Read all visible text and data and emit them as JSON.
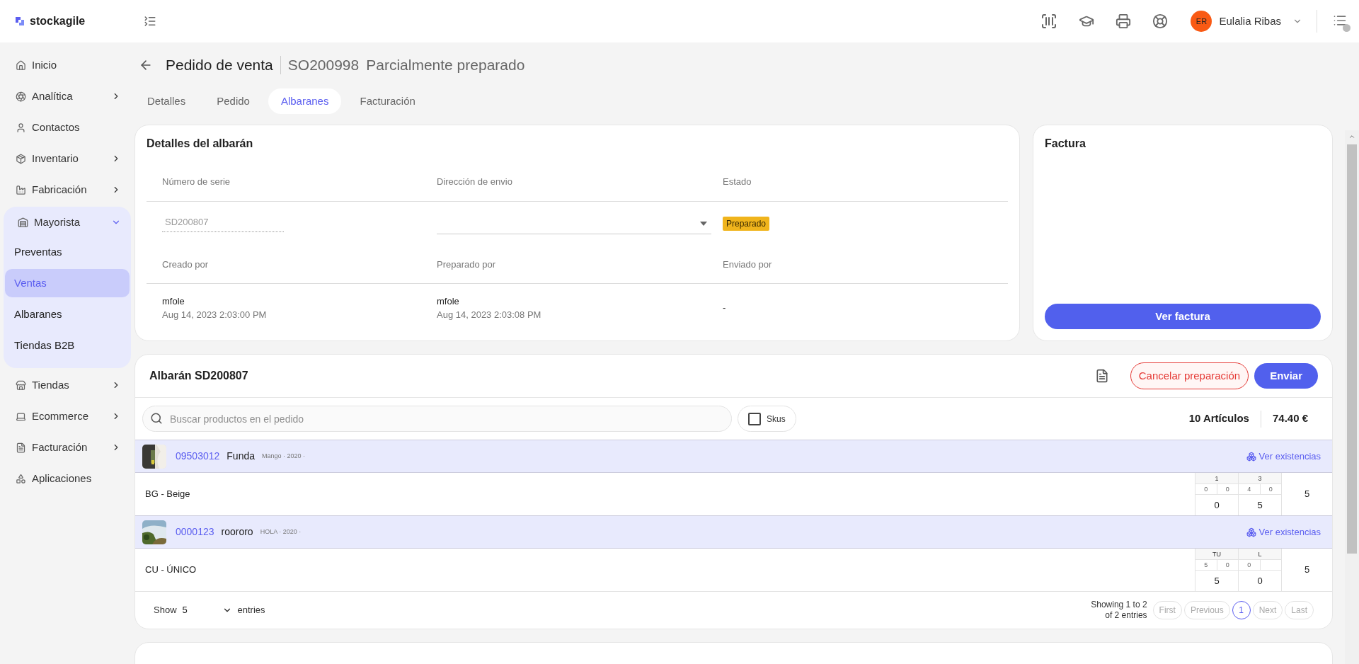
{
  "brand": {
    "name": "stockagile"
  },
  "topbar": {
    "user": {
      "initials": "ER",
      "name": "Eulalia Ribas"
    }
  },
  "sidebar": {
    "items": [
      {
        "label": "Inicio",
        "has_children": false,
        "expanded": false
      },
      {
        "label": "Analítica",
        "has_children": true,
        "expanded": false
      },
      {
        "label": "Contactos",
        "has_children": false,
        "expanded": false
      },
      {
        "label": "Inventario",
        "has_children": true,
        "expanded": false
      },
      {
        "label": "Fabricación",
        "has_children": true,
        "expanded": false
      },
      {
        "label": "Mayorista",
        "has_children": true,
        "expanded": true,
        "children": [
          {
            "label": "Preventas",
            "selected": false
          },
          {
            "label": "Ventas",
            "selected": true
          },
          {
            "label": "Albaranes",
            "selected": false
          },
          {
            "label": "Tiendas B2B",
            "selected": false
          }
        ]
      },
      {
        "label": "Tiendas",
        "has_children": true,
        "expanded": false
      },
      {
        "label": "Ecommerce",
        "has_children": true,
        "expanded": false
      },
      {
        "label": "Facturación",
        "has_children": true,
        "expanded": false
      },
      {
        "label": "Aplicaciones",
        "has_children": false,
        "expanded": false
      }
    ]
  },
  "page": {
    "title": "Pedido de venta",
    "code": "SO200998",
    "status": "Parcialmente preparado"
  },
  "tabs": [
    {
      "label": "Detalles",
      "selected": false
    },
    {
      "label": "Pedido",
      "selected": false
    },
    {
      "label": "Albaranes",
      "selected": true
    },
    {
      "label": "Facturación",
      "selected": false
    }
  ],
  "details": {
    "title": "Detalles del albarán",
    "labels_1": [
      "Número de serie",
      "Dirección de envio",
      "Estado"
    ],
    "serial": "SD200807",
    "status_badge": "Preparado",
    "labels_2": [
      "Creado por",
      "Preparado por",
      "Enviado por"
    ],
    "people": [
      {
        "user": "mfole",
        "date": "Aug 14, 2023 2:03:00 PM"
      },
      {
        "user": "mfole",
        "date": "Aug 14, 2023 2:03:08 PM"
      }
    ],
    "sent_by": "-"
  },
  "invoice": {
    "title": "Factura",
    "button": "Ver factura"
  },
  "albaran": {
    "title": "Albarán SD200807",
    "cancel": "Cancelar preparación",
    "send": "Enviar",
    "search_placeholder": "Buscar productos en el pedido",
    "skus": {
      "label": "Skus",
      "checked": false
    },
    "items_count": "10 Artículos",
    "total": "74.40 €",
    "products": [
      {
        "code": "09503012",
        "name": "Funda",
        "meta": "Mango · 2020 ·",
        "link": "Ver existencias",
        "variant": "BG - Beige",
        "matrix": [
          {
            "header": "1",
            "sub": [
              "0",
              "0"
            ],
            "value": "0"
          },
          {
            "header": "3",
            "sub": [
              "4",
              "0"
            ],
            "value": "5"
          }
        ],
        "total": "5"
      },
      {
        "code": "0000123",
        "name": "roororo",
        "meta": "HOLA · 2020 ·",
        "link": "Ver existencias",
        "variant": "CU - ÚNICO",
        "matrix": [
          {
            "header": "TU",
            "sub": [
              "5",
              "0"
            ],
            "value": "5"
          },
          {
            "header": "L",
            "sub": [
              "0"
            ],
            "value": "0"
          }
        ],
        "total": "5"
      }
    ],
    "footer": {
      "show": "Show",
      "page_size": "5",
      "entries": "entries",
      "showing_1": "Showing 1 to 2",
      "showing_2": "of 2 entries",
      "pages": [
        {
          "label": "First",
          "selected": false,
          "disabled": true
        },
        {
          "label": "Previous",
          "selected": false,
          "disabled": true
        },
        {
          "label": "1",
          "selected": true,
          "disabled": false
        },
        {
          "label": "Next",
          "selected": false,
          "disabled": true
        },
        {
          "label": "Last",
          "selected": false,
          "disabled": true
        }
      ]
    }
  }
}
